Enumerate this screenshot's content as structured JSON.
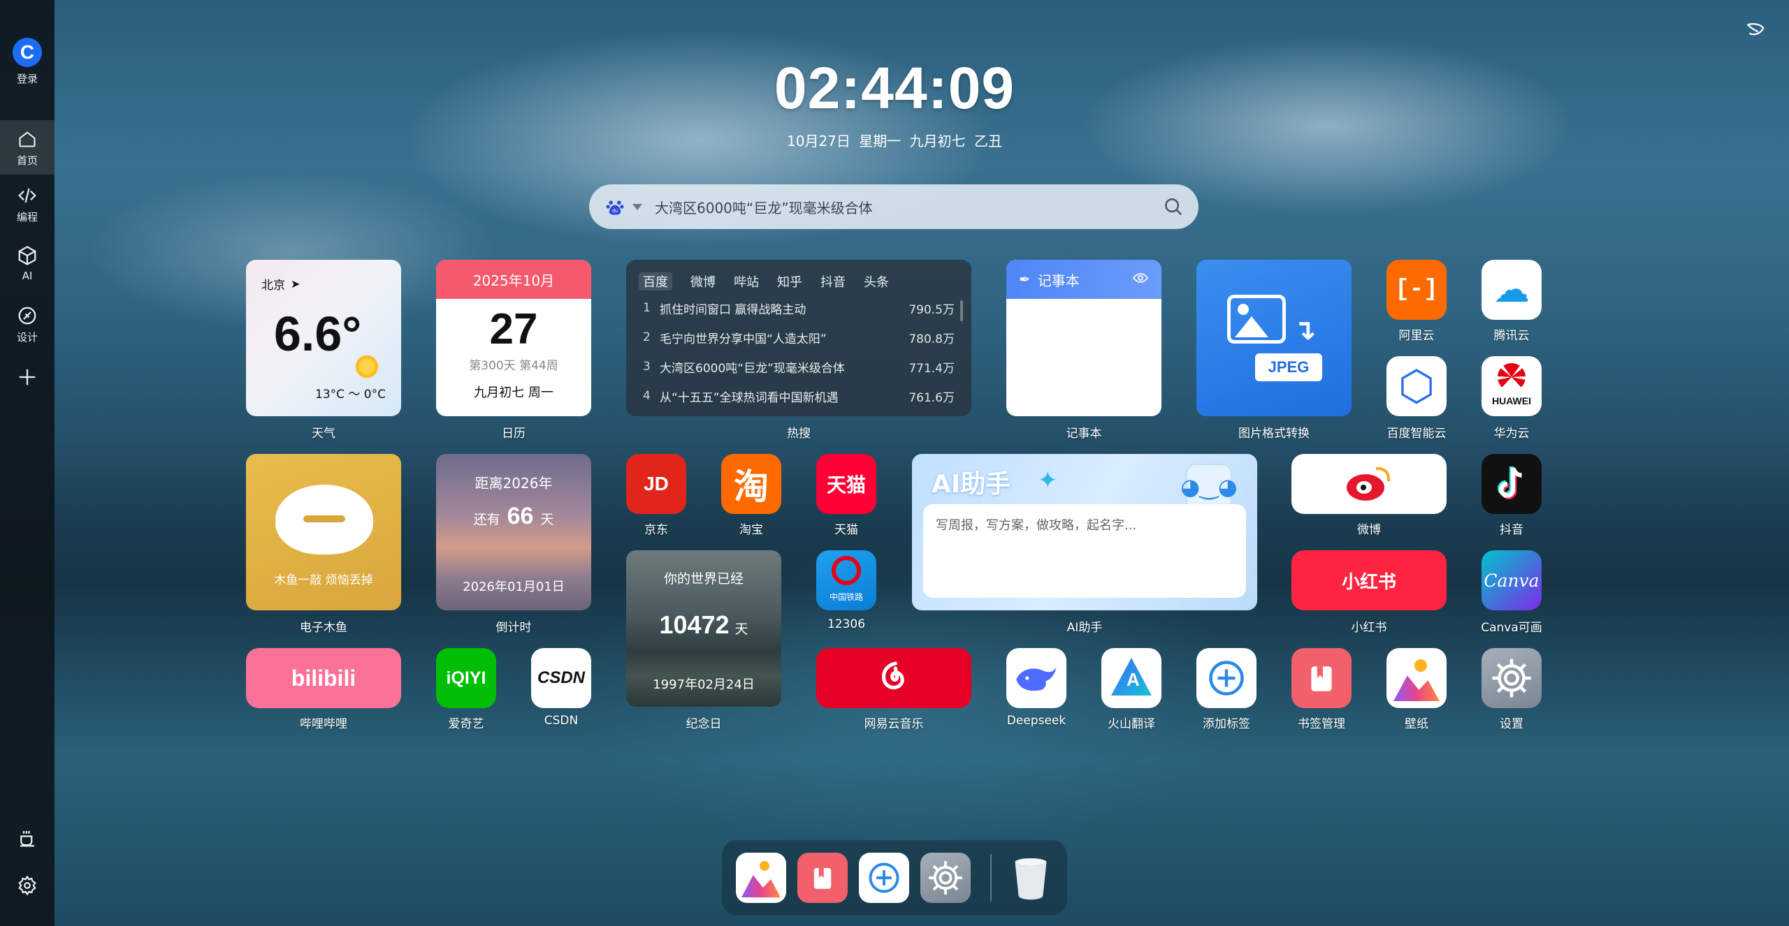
{
  "sidebar": {
    "login": "登录",
    "items": [
      {
        "label": "首页",
        "icon": "home-icon"
      },
      {
        "label": "编程",
        "icon": "code-icon"
      },
      {
        "label": "AI",
        "icon": "cube-icon"
      },
      {
        "label": "设计",
        "icon": "design-icon"
      }
    ]
  },
  "clock": {
    "time": "02:44:09",
    "date": "10月27日  星期一  九月初七  乙丑"
  },
  "search": {
    "placeholder": "大湾区6000吨“巨龙”现毫米级合体",
    "engine_icon": "baidu-icon"
  },
  "weather": {
    "city": "北京",
    "temp": "6.6°",
    "range": "13°C ～ 0°C",
    "label": "天气"
  },
  "calendar": {
    "month": "2025年10月",
    "day": "27",
    "week": "第300天 第44周",
    "lunar": "九月初七 周一",
    "label": "日历"
  },
  "hot": {
    "tabs": [
      "百度",
      "微博",
      "哔站",
      "知乎",
      "抖音",
      "头条"
    ],
    "rows": [
      {
        "n": "1",
        "t": "抓住时间窗口 赢得战略主动",
        "v": "790.5万"
      },
      {
        "n": "2",
        "t": "毛宁向世界分享中国“人造太阳”",
        "v": "780.8万"
      },
      {
        "n": "3",
        "t": "大湾区6000吨“巨龙”现毫米级合体",
        "v": "771.4万"
      },
      {
        "n": "4",
        "t": "从“十五五”全球热词看中国新机遇",
        "v": "761.6万"
      }
    ],
    "label": "热搜"
  },
  "notepad": {
    "title": "记事本",
    "label": "记事本"
  },
  "imgconv": {
    "badge": "JPEG",
    "label": "图片格式转换"
  },
  "apps_top": [
    {
      "label": "阿里云",
      "text": "[-]",
      "bg": "#ff6a00"
    },
    {
      "label": "腾讯云",
      "text": "☁",
      "bg": "#ffffff"
    },
    {
      "label": "百度智能云",
      "text": "⬡",
      "bg": "#ffffff"
    },
    {
      "label": "华为云",
      "text": "HUAWEI",
      "bg": "#ffffff"
    }
  ],
  "muyu": {
    "text": "木鱼一敲 烦恼丢掉",
    "label": "电子木鱼"
  },
  "countdown": {
    "title": "距离2026年",
    "prefix": "还有",
    "days": "66",
    "unit": "天",
    "date": "2026年01月01日",
    "label": "倒计时"
  },
  "shop": [
    {
      "label": "京东",
      "text": "JD",
      "bg": "#e1251b"
    },
    {
      "label": "淘宝",
      "text": "淘",
      "bg": "#ff6a00"
    },
    {
      "label": "天猫",
      "text": "天猫",
      "bg": "#ff0036"
    }
  ],
  "rail": {
    "label": "12306",
    "text": "中国铁路"
  },
  "memorial": {
    "title": "你的世界已经",
    "days": "10472",
    "unit": "天",
    "date": "1997年02月24日",
    "label": "纪念日"
  },
  "ai": {
    "title": "AI助手",
    "placeholder": "写周报，写方案，做攻略，起名字...",
    "label": "AI助手"
  },
  "weibo": {
    "label": "微博"
  },
  "douyin": {
    "label": "抖音"
  },
  "xhs": {
    "text": "小红书",
    "label": "小红书"
  },
  "canva": {
    "text": "Canva",
    "label": "Canva可画"
  },
  "bili": {
    "text": "bilibili",
    "label": "哔哩哔哩"
  },
  "iqiyi": {
    "text": "iQIYI",
    "label": "爱奇艺"
  },
  "csdn": {
    "text": "CSDN",
    "label": "CSDN"
  },
  "music": {
    "label": "网易云音乐"
  },
  "row3": [
    {
      "label": "Deepseek"
    },
    {
      "label": "火山翻译"
    },
    {
      "label": "添加标签"
    },
    {
      "label": "书签管理"
    },
    {
      "label": "壁纸"
    },
    {
      "label": "设置"
    }
  ],
  "colors": {
    "accent": "#1b6ef3",
    "sidebar": "#0e161c"
  }
}
